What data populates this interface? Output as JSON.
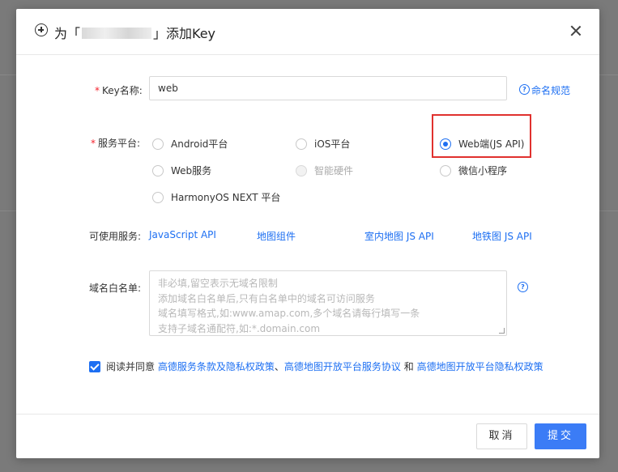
{
  "dialog": {
    "title_prefix": "为「",
    "title_suffix": "」添加Key",
    "close": "×"
  },
  "key_name": {
    "label": "Key名称:",
    "required_mark": "*",
    "value": "web",
    "help_link": "命名规范"
  },
  "platform": {
    "label": "服务平台:",
    "required_mark": "*",
    "options": [
      {
        "label": "Android平台",
        "checked": false,
        "disabled": false
      },
      {
        "label": "iOS平台",
        "checked": false,
        "disabled": false
      },
      {
        "label": "Web端(JS API)",
        "checked": true,
        "disabled": false
      },
      {
        "label": "Web服务",
        "checked": false,
        "disabled": false
      },
      {
        "label": "智能硬件",
        "checked": false,
        "disabled": true
      },
      {
        "label": "微信小程序",
        "checked": false,
        "disabled": false
      },
      {
        "label": "HarmonyOS NEXT 平台",
        "checked": false,
        "disabled": false
      }
    ]
  },
  "available_services": {
    "label": "可使用服务:",
    "items": [
      "JavaScript API",
      "地图组件",
      "室内地图 JS API",
      "地铁图 JS API"
    ]
  },
  "whitelist": {
    "label": "域名白名单:",
    "placeholder_lines": [
      "非必填,留空表示无域名限制",
      "添加域名白名单后,只有白名单中的域名可访问服务",
      "域名填写格式,如:www.amap.com,多个域名请每行填写一条",
      "支持子域名通配符,如:*.domain.com"
    ]
  },
  "agreement": {
    "checked": true,
    "prefix": "阅读并同意",
    "link1": "高德服务条款及隐私权政策",
    "sep": "、",
    "link2": "高德地图开放平台服务协议",
    "and": "和",
    "link3": "高德地图开放平台隐私权政策"
  },
  "footer": {
    "cancel": "取消",
    "submit": "提交"
  },
  "colors": {
    "accent": "#1d6ff2",
    "highlight": "#e0312e",
    "required": "#f5222d"
  }
}
